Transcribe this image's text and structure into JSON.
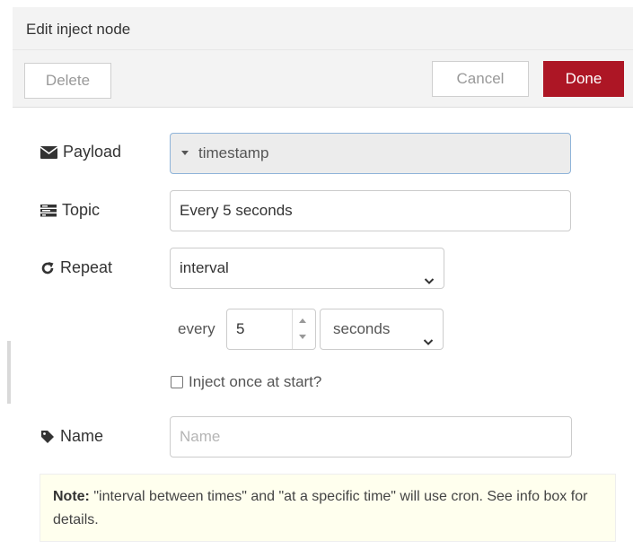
{
  "tray": {
    "title": "Edit inject node"
  },
  "toolbar": {
    "delete_label": "Delete",
    "cancel_label": "Cancel",
    "done_label": "Done"
  },
  "form": {
    "payload": {
      "label": "Payload",
      "icon": "envelope-icon",
      "value": "timestamp"
    },
    "topic": {
      "label": "Topic",
      "icon": "tasks-icon",
      "value": "Every 5 seconds"
    },
    "repeat": {
      "label": "Repeat",
      "icon": "repeat-icon",
      "value": "interval"
    },
    "interval": {
      "every_label": "every",
      "count": "5",
      "units": "seconds"
    },
    "once": {
      "label": "Inject once at start?",
      "checked": false
    },
    "name": {
      "label": "Name",
      "icon": "tag-icon",
      "placeholder": "Name",
      "value": ""
    }
  },
  "note": {
    "bold": "Note:",
    "text": " \"interval between times\" and \"at a specific time\" will use cron. See info box for details."
  },
  "colors": {
    "done_bg": "#ad1625",
    "header_bg": "#f3f3f3",
    "note_bg": "#ffffee"
  }
}
